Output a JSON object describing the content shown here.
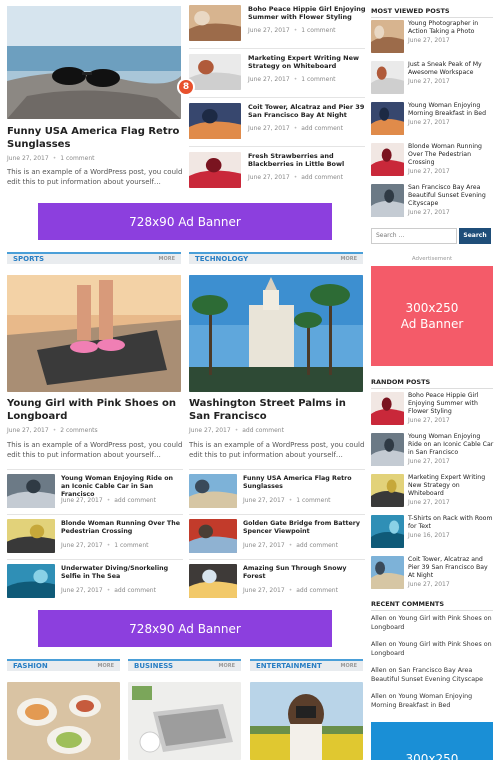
{
  "colors": {
    "accent": "#4a9fd8",
    "banner_purple": "#8c3fde",
    "banner_red": "#f45b69",
    "banner_blue": "#1a8fd6",
    "search_btn": "#1f4e79"
  },
  "featured": {
    "title": "Funny USA America Flag Retro Sunglasses",
    "date": "June 27, 2017",
    "comments": "1 comment",
    "excerpt": "This is an example of a WordPress post, you could edit this to put information about yourself…"
  },
  "top_list": [
    {
      "title": "Boho Peace Hippie Girl Enjoying Summer with Flower Styling",
      "date": "June 27, 2017",
      "comments": "1 comment"
    },
    {
      "title": "Marketing Expert Writing New Strategy on Whiteboard",
      "date": "June 27, 2017",
      "comments": "1 comment",
      "badge": "8"
    },
    {
      "title": "Coit Tower, Alcatraz and Pier 39 San Francisco Bay At Night",
      "date": "June 27, 2017",
      "comments": "add comment"
    },
    {
      "title": "Fresh Strawberries and Blackberries in Little Bowl",
      "date": "June 27, 2017",
      "comments": "add comment"
    }
  ],
  "banner1": "728x90 Ad Banner",
  "banner2": "728x90 Ad Banner",
  "sports": {
    "label": "SPORTS",
    "more": "MORE",
    "main": {
      "title": "Young Girl with Pink Shoes on Longboard",
      "date": "June 27, 2017",
      "comments": "2 comments",
      "excerpt": "This is an example of a WordPress post, you could edit this to put information about yourself…"
    },
    "list": [
      {
        "title": "Young Woman Enjoying Ride on an Iconic Cable Car in San Francisco",
        "date": "June 27, 2017",
        "comments": "add comment"
      },
      {
        "title": "Blonde Woman Running Over The Pedestrian Crossing",
        "date": "June 27, 2017",
        "comments": "1 comment"
      },
      {
        "title": "Underwater Diving/Snorkeling Selfie in The Sea",
        "date": "June 27, 2017",
        "comments": "add comment"
      }
    ]
  },
  "technology": {
    "label": "TECHNOLOGY",
    "more": "MORE",
    "main": {
      "title": "Washington Street Palms in San Francisco",
      "date": "June 27, 2017",
      "comments": "add comment",
      "excerpt": "This is an example of a WordPress post, you could edit this to put information about yourself…"
    },
    "list": [
      {
        "title": "Funny USA America Flag Retro Sunglasses",
        "date": "June 27, 2017",
        "comments": "1 comment"
      },
      {
        "title": "Golden Gate Bridge from Battery Spencer Viewpoint",
        "date": "June 27, 2017",
        "comments": "add comment"
      },
      {
        "title": "Amazing Sun Through Snowy Forest",
        "date": "June 27, 2017",
        "comments": "add comment"
      }
    ]
  },
  "bottom_sections": [
    {
      "label": "FASHION",
      "more": "MORE"
    },
    {
      "label": "BUSINESS",
      "more": "MORE"
    },
    {
      "label": "ENTERTAINMENT",
      "more": "MORE"
    }
  ],
  "sidebar": {
    "most_viewed_title": "MOST VIEWED POSTS",
    "most_viewed": [
      {
        "title": "Young Photographer in Action Taking a Photo",
        "date": "June 27, 2017"
      },
      {
        "title": "Just a Sneak Peak of My Awesome Workspace",
        "date": "June 27, 2017"
      },
      {
        "title": "Young Woman Enjoying Morning Breakfast in Bed",
        "date": "June 27, 2017"
      },
      {
        "title": "Blonde Woman Running Over The Pedestrian Crossing",
        "date": "June 27, 2017"
      },
      {
        "title": "San Francisco Bay Area Beautiful Sunset Evening Cityscape",
        "date": "June 27, 2017"
      }
    ],
    "search_placeholder": "Search …",
    "search_button": "Search",
    "advertisement": "Advertisement",
    "ad_300": "300x250\nAd Banner",
    "random_title": "RANDOM POSTS",
    "random": [
      {
        "title": "Boho Peace Hippie Girl Enjoying Summer with Flower Styling",
        "date": "June 27, 2017"
      },
      {
        "title": "Young Woman Enjoying Ride on an Iconic Cable Car in San Francisco",
        "date": "June 27, 2017"
      },
      {
        "title": "Marketing Expert Writing New Strategy on Whiteboard",
        "date": "June 27, 2017"
      },
      {
        "title": "T-Shirts on Rack with Room for Text",
        "date": "June 16, 2017"
      },
      {
        "title": "Coit Tower, Alcatraz and Pier 39 San Francisco Bay At Night",
        "date": "June 27, 2017"
      }
    ],
    "comments_title": "RECENT COMMENTS",
    "comments": [
      {
        "author": "Allen",
        "on": "on",
        "post": "Young Girl with Pink Shoes on Longboard"
      },
      {
        "author": "Allen",
        "on": "on",
        "post": "Young Girl with Pink Shoes on Longboard"
      },
      {
        "author": "Allen",
        "on": "on",
        "post": "San Francisco Bay Area Beautiful Sunset Evening Cityscape"
      },
      {
        "author": "Allen",
        "on": "on",
        "post": "Young Woman Enjoying Morning Breakfast in Bed"
      }
    ],
    "ad_bottom": "300x250"
  }
}
